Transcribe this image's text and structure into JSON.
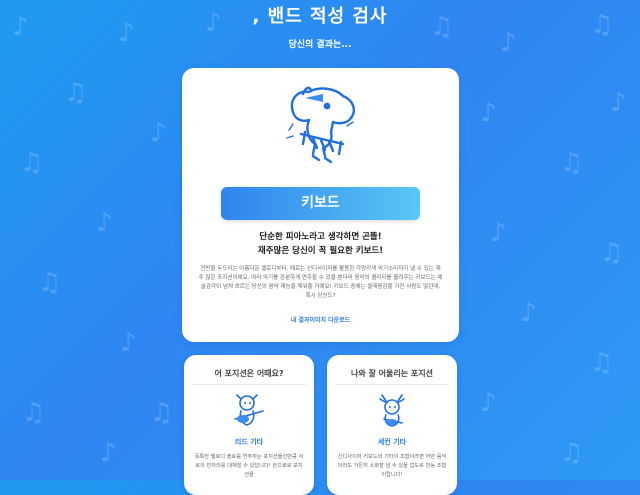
{
  "header": {
    "title": ", 밴드 적성 검사",
    "subtitle": "당신의 결과는..."
  },
  "result": {
    "name": "키보드",
    "headline_1": "단순한 피아노라고 생각하면 곤뜰!",
    "headline_2": "재주많은 당신이 꼭 필요한 키보드!",
    "description": "전반을 두드리는 아름다운 멜로디부터, 때로는 신디사이저를 활용한 각양각색 악기소리까지 낼 수 있는 재주 많은 포지션이에요. 여러 악기를 관분하게 연주할 수 있을 뿐더러 음악의 퀄리티를 올려주는 키보드는 예술감각이 넘쳐 흐르는 당신의 음악 재능을 깨워줄 거예요! 키보드 중에는 클래음감을 가진 사람도 많던데, 혹시 당신도?",
    "download_label": "내 결과이미지 다운로드"
  },
  "cards": {
    "left": {
      "heading": "어 포지션은 어때요?",
      "position_name": "리드 기타",
      "description": "독특한 멜로디 솔로를 연주하는 포지션들인만큼 서로의 빈자리를 대체할 수 있답니다! 한으로로 포지션을"
    },
    "right": {
      "heading": "나와 잘 어울리는 포지션",
      "position_name": "세컨 기타",
      "description": "신디사이저 키보드와 기타의 조합이라면 어떤 음악이라도 거뜬히 소화할 넘 수 있을 겁도로 만능 조합이랍니다!"
    }
  },
  "icons": {
    "background": "music-note-icon",
    "mascot": "keyboard-player-mascot-icon",
    "left_character": "guitar-player-character-icon",
    "right_character": "second-guitar-character-icon"
  },
  "colors": {
    "background": "#2f86f2",
    "accent": "#2b7de9",
    "banner_start": "#2f84ee",
    "banner_end": "#59c7f4"
  }
}
